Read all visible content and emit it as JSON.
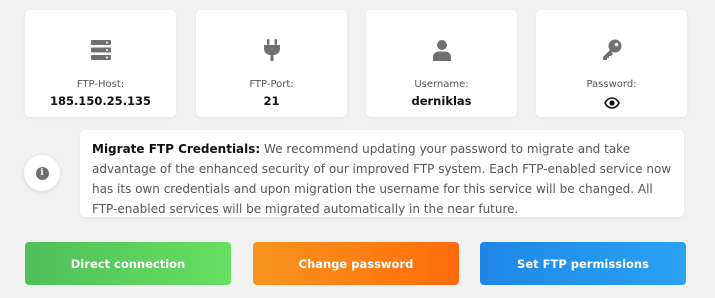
{
  "cards": [
    {
      "label": "FTP-Host:",
      "value": "185.150.25.135",
      "icon": "server-icon"
    },
    {
      "label": "FTP-Port:",
      "value": "21",
      "icon": "plug-icon"
    },
    {
      "label": "Username:",
      "value": "derniklas",
      "icon": "user-icon"
    },
    {
      "label": "Password:",
      "value_icon": "eye-icon",
      "icon": "key-icon"
    }
  ],
  "notice": {
    "title": "Migrate FTP Credentials:",
    "body": " We recommend updating your password to migrate and take advantage of the enhanced security of our improved FTP system. Each FTP-enabled service now has its own credentials and upon migration the username for this service will be changed. All FTP-enabled services will be migrated automatically in the near future.",
    "icon": "info-icon"
  },
  "buttons": {
    "direct": "Direct connection",
    "change_password": "Change password",
    "permissions": "Set FTP permissions"
  },
  "colors": {
    "icon_gray": "#707070",
    "green": "#5cc95c",
    "orange": "#fb7f17",
    "blue": "#2494ec"
  }
}
